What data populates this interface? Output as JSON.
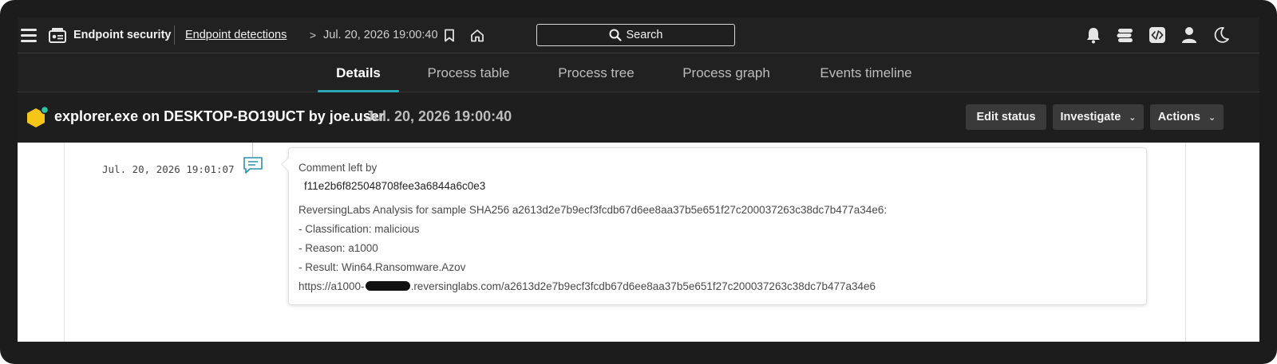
{
  "topbar": {
    "product_name": "Endpoint security",
    "breadcrumb_link": "Endpoint detections",
    "breadcrumb_separator": ">",
    "breadcrumb_current": "Jul. 20, 2026 19:00:40",
    "search_label": "Search",
    "icons": [
      "menu-icon",
      "product-icon",
      "bookmark-icon",
      "home-icon",
      "search-icon",
      "bell-icon",
      "stack-icon",
      "code-icon",
      "user-icon",
      "moon-icon"
    ]
  },
  "tabs": [
    {
      "label": "Details",
      "active": true
    },
    {
      "label": "Process table",
      "active": false
    },
    {
      "label": "Process tree",
      "active": false
    },
    {
      "label": "Process graph",
      "active": false
    },
    {
      "label": "Events timeline",
      "active": false
    }
  ],
  "detection": {
    "title": "explorer.exe on DESKTOP-BO19UCT by joe.user",
    "timestamp": "Jul. 20, 2026 19:00:40",
    "severity_color": "#f5c518",
    "status_dot_color": "#2ec4a5"
  },
  "actions": {
    "edit_status": "Edit status",
    "investigate": "Investigate",
    "actions": "Actions"
  },
  "timeline": {
    "entry_time": "Jul. 20, 2026 19:01:07",
    "comment": {
      "heading": "Comment left by",
      "author": "f11e2b6f825048708fee3a6844a6c0e3",
      "line1": "ReversingLabs Analysis for sample SHA256 a2613d2e7b9ecf3fcdb67d6ee8aa37b5e651f27c200037263c38dc7b477a34e6:",
      "line2": "- Classification: malicious",
      "line3": "- Reason: a1000",
      "line4": "- Result: Win64.Ransomware.Azov",
      "url_prefix": "https://a1000-",
      "url_suffix": ".reversinglabs.com/a2613d2e7b9ecf3fcdb67d6ee8aa37b5e651f27c200037263c38dc7b477a34e6"
    }
  },
  "colors": {
    "accent": "#2aa8b6",
    "background": "#212121"
  }
}
